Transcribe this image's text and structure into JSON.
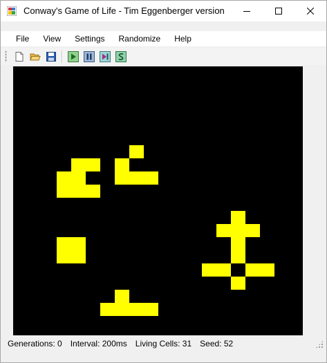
{
  "window": {
    "title": "Conway's Game of Life - Tim Eggenberger version"
  },
  "menu": {
    "items": [
      "File",
      "View",
      "Settings",
      "Randomize",
      "Help"
    ]
  },
  "toolbar": {
    "buttons": [
      {
        "icon": "new-file-icon"
      },
      {
        "icon": "open-folder-icon"
      },
      {
        "icon": "save-disk-icon"
      },
      {
        "icon": "play-icon"
      },
      {
        "icon": "pause-icon"
      },
      {
        "icon": "step-icon"
      },
      {
        "icon": "seed-icon"
      }
    ]
  },
  "board": {
    "background": "#000000",
    "cell_color": "#ffff00",
    "live_cells": [
      [
        3,
        13
      ],
      [
        4,
        13
      ],
      [
        3,
        14
      ],
      [
        4,
        14
      ],
      [
        7,
        17
      ],
      [
        6,
        18
      ],
      [
        7,
        18
      ],
      [
        8,
        18
      ],
      [
        9,
        18
      ],
      [
        15,
        11
      ],
      [
        14,
        12
      ],
      [
        15,
        12
      ],
      [
        16,
        12
      ],
      [
        15,
        13
      ],
      [
        15,
        14
      ],
      [
        13,
        15
      ],
      [
        14,
        15
      ],
      [
        16,
        15
      ],
      [
        17,
        15
      ],
      [
        15,
        16
      ],
      [
        4,
        7
      ],
      [
        5,
        7
      ],
      [
        3,
        8
      ],
      [
        4,
        8
      ],
      [
        3,
        9
      ],
      [
        4,
        9
      ],
      [
        5,
        9
      ],
      [
        8,
        6
      ],
      [
        7,
        7
      ],
      [
        7,
        8
      ],
      [
        8,
        8
      ],
      [
        9,
        8
      ]
    ]
  },
  "status": {
    "generations": "Generations: 0",
    "interval": "Interval: 200ms",
    "living_cells": "Living Cells: 31",
    "seed": "Seed: 52"
  }
}
